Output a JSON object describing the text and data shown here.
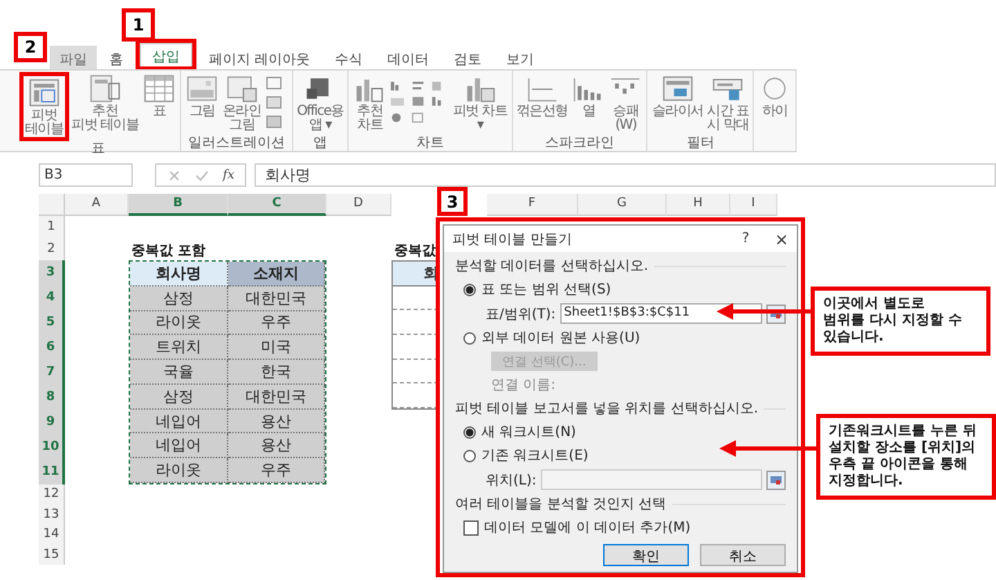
{
  "badges": [
    "1",
    "2",
    "3"
  ],
  "ribbon": {
    "tabs": [
      {
        "label": "파일",
        "kind": "file",
        "selected": false
      },
      {
        "label": "홈",
        "kind": "tab",
        "selected": false
      },
      {
        "label": "삽입",
        "kind": "tab",
        "selected": true
      },
      {
        "label": "페이지 레이아웃",
        "kind": "tab",
        "selected": false
      },
      {
        "label": "수식",
        "kind": "tab",
        "selected": false
      },
      {
        "label": "데이터",
        "kind": "tab",
        "selected": false
      },
      {
        "label": "검토",
        "kind": "tab",
        "selected": false
      },
      {
        "label": "보기",
        "kind": "tab",
        "selected": false
      }
    ],
    "groups": [
      {
        "label": "표",
        "items": [
          {
            "kind": "button",
            "lines": "피벗\n테이블"
          },
          {
            "kind": "button",
            "lines": "추천\n피벗 테이블"
          },
          {
            "kind": "button",
            "lines": "표"
          }
        ]
      },
      {
        "label": "일러스트레이션",
        "items": [
          {
            "kind": "button",
            "lines": "그림"
          },
          {
            "kind": "button",
            "lines": "온라인\n그림"
          },
          {
            "kind": "icon-stack"
          }
        ]
      },
      {
        "label": "앱",
        "items": [
          {
            "kind": "button",
            "lines": "Office용\n앱 ▾"
          }
        ]
      },
      {
        "label": "차트",
        "items": [
          {
            "kind": "button",
            "lines": "추천\n차트"
          },
          {
            "kind": "icon-grid"
          },
          {
            "kind": "button",
            "lines": "피벗 차트\n▾"
          }
        ]
      },
      {
        "label": "스파크라인",
        "items": [
          {
            "kind": "button",
            "lines": "꺾은선형"
          },
          {
            "kind": "button",
            "lines": "열"
          },
          {
            "kind": "button",
            "lines": "승패\n(W)"
          }
        ]
      },
      {
        "label": "필터",
        "items": [
          {
            "kind": "button",
            "lines": "슬라이서"
          },
          {
            "kind": "button",
            "lines": "시간 표\n시 막대"
          }
        ]
      },
      {
        "items": [
          {
            "kind": "button",
            "lines": "하이"
          }
        ]
      }
    ]
  },
  "formula_bar": {
    "name_box": "B3",
    "fx": "fx",
    "value": "회사명"
  },
  "sheet": {
    "columns": [
      {
        "label": "A",
        "selected": false
      },
      {
        "label": "B",
        "selected": true
      },
      {
        "label": "C",
        "selected": true
      },
      {
        "label": "D",
        "selected": false
      },
      {
        "label": "F",
        "selected": false
      },
      {
        "label": "G",
        "selected": false
      },
      {
        "label": "H",
        "selected": false
      },
      {
        "label": "I",
        "selected": false
      }
    ],
    "rows": [
      {
        "label": "1",
        "selected": false
      },
      {
        "label": "2",
        "selected": false
      },
      {
        "label": "3",
        "selected": true
      },
      {
        "label": "4",
        "selected": true
      },
      {
        "label": "5",
        "selected": true
      },
      {
        "label": "6",
        "selected": true
      },
      {
        "label": "7",
        "selected": true
      },
      {
        "label": "8",
        "selected": true
      },
      {
        "label": "9",
        "selected": true
      },
      {
        "label": "10",
        "selected": true
      },
      {
        "label": "11",
        "selected": true
      },
      {
        "label": "12",
        "selected": false
      },
      {
        "label": "13",
        "selected": false
      },
      {
        "label": "14",
        "selected": false
      },
      {
        "label": "15",
        "selected": false
      }
    ],
    "title": "중복값 포함",
    "table": {
      "header": [
        "회사명",
        "소재지"
      ],
      "rows": [
        [
          "삼정",
          "대한민국"
        ],
        [
          "라이옷",
          "우주"
        ],
        [
          "트위치",
          "미국"
        ],
        [
          "국율",
          "한국"
        ],
        [
          "삼정",
          "대한민국"
        ],
        [
          "네입어",
          "용산"
        ],
        [
          "네입어",
          "용산"
        ],
        [
          "라이옷",
          "우주"
        ]
      ]
    },
    "second_title": "중복값",
    "second_header": "회"
  },
  "dialog": {
    "title": "피벗 테이블 만들기",
    "help": "?",
    "close": "×",
    "source_heading": "분석할 데이터를 선택하십시오.",
    "source_options": [
      {
        "label": "표 또는 범위 선택(S)",
        "selected": true
      },
      {
        "label": "외부 데이터 원본 사용(U)",
        "selected": false
      }
    ],
    "range_label": "표/범위(T):",
    "range_value": "Sheet1!$B$3:$C$11",
    "connection_button": "연결 선택(C)...",
    "connection_name": "연결 이름:",
    "location_heading": "피벗 테이블 보고서를 넣을 위치를 선택하십시오.",
    "location_options": [
      {
        "label": "새 워크시트(N)",
        "selected": true
      },
      {
        "label": "기존 워크시트(E)",
        "selected": false
      }
    ],
    "location_label": "위치(L):",
    "multi_heading": "여러 테이블을 분석할 것인지 선택",
    "data_model": {
      "label": "데이터 모델에 이 데이터 추가(M)",
      "checked": false
    },
    "buttons": [
      "확인",
      "취소"
    ]
  },
  "callouts": [
    "이곳에서 별도로\n범위를 다시 지정할 수\n있습니다.",
    "기존워크시트를 누른 뒤\n설치할 장소를 [위치]의\n우측 끝 아이콘을 통해\n지정합니다."
  ]
}
